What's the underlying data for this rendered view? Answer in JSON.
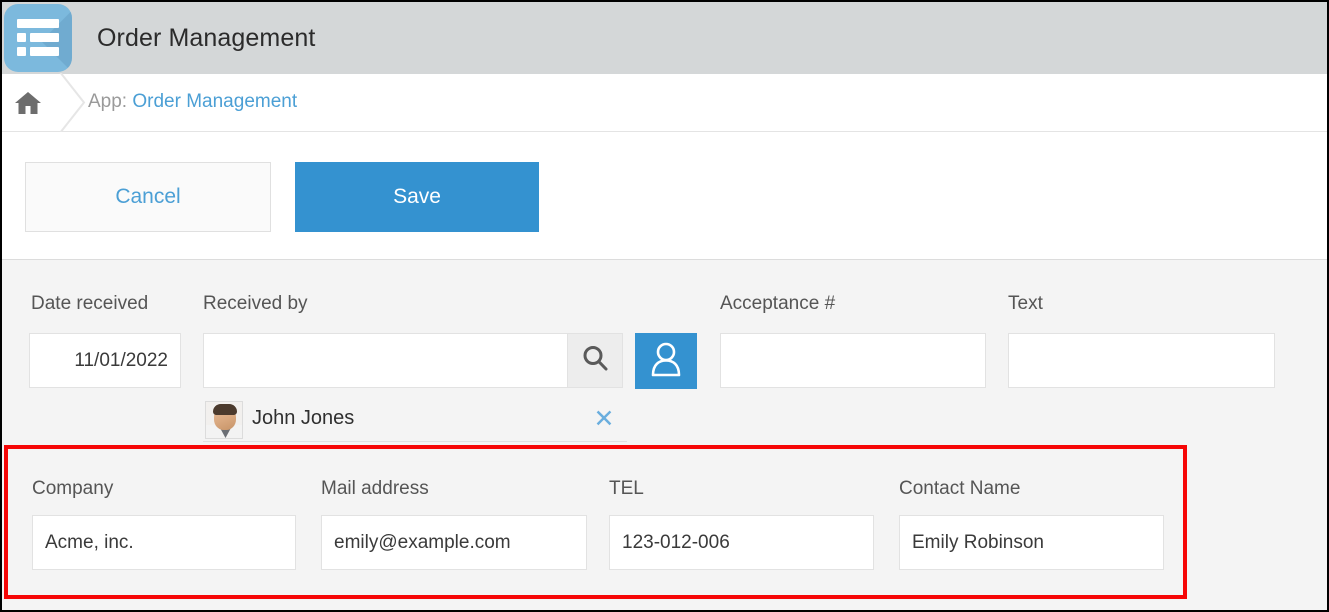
{
  "app": {
    "icon_name": "list-app-icon",
    "title": "Order Management",
    "accent_color": "#3492d0",
    "icon_color": "#7cb9dd",
    "header_bg": "#d4d7d8"
  },
  "breadcrumb": {
    "home_icon": "home-icon",
    "separator_icon": "chevron-right-icon",
    "prefix": "App:",
    "link_label": "Order Management",
    "link_color": "#4b9fd5"
  },
  "actions": {
    "cancel_label": "Cancel",
    "save_label": "Save"
  },
  "form": {
    "fields": [
      {
        "key": "date_received",
        "label": "Date received",
        "value": "11/01/2022"
      },
      {
        "key": "received_by",
        "label": "Received by",
        "value": ""
      },
      {
        "key": "acceptance_no",
        "label": "Acceptance #",
        "value": ""
      },
      {
        "key": "text",
        "label": "Text",
        "value": ""
      }
    ],
    "received_by": {
      "search_icon": "search-icon",
      "user_picker_icon": "user-icon",
      "selected_user": {
        "name": "John Jones",
        "avatar_name": "user-avatar",
        "remove_icon": "close-icon",
        "remove_glyph": "✕"
      }
    }
  },
  "highlight": {
    "border_color": "#f60606",
    "fields": [
      {
        "key": "company",
        "label": "Company",
        "value": "Acme, inc."
      },
      {
        "key": "mail_address",
        "label": "Mail address",
        "value": "emily@example.com"
      },
      {
        "key": "tel",
        "label": "TEL",
        "value": "123-012-006"
      },
      {
        "key": "contact_name",
        "label": "Contact Name",
        "value": "Emily Robinson"
      }
    ]
  }
}
